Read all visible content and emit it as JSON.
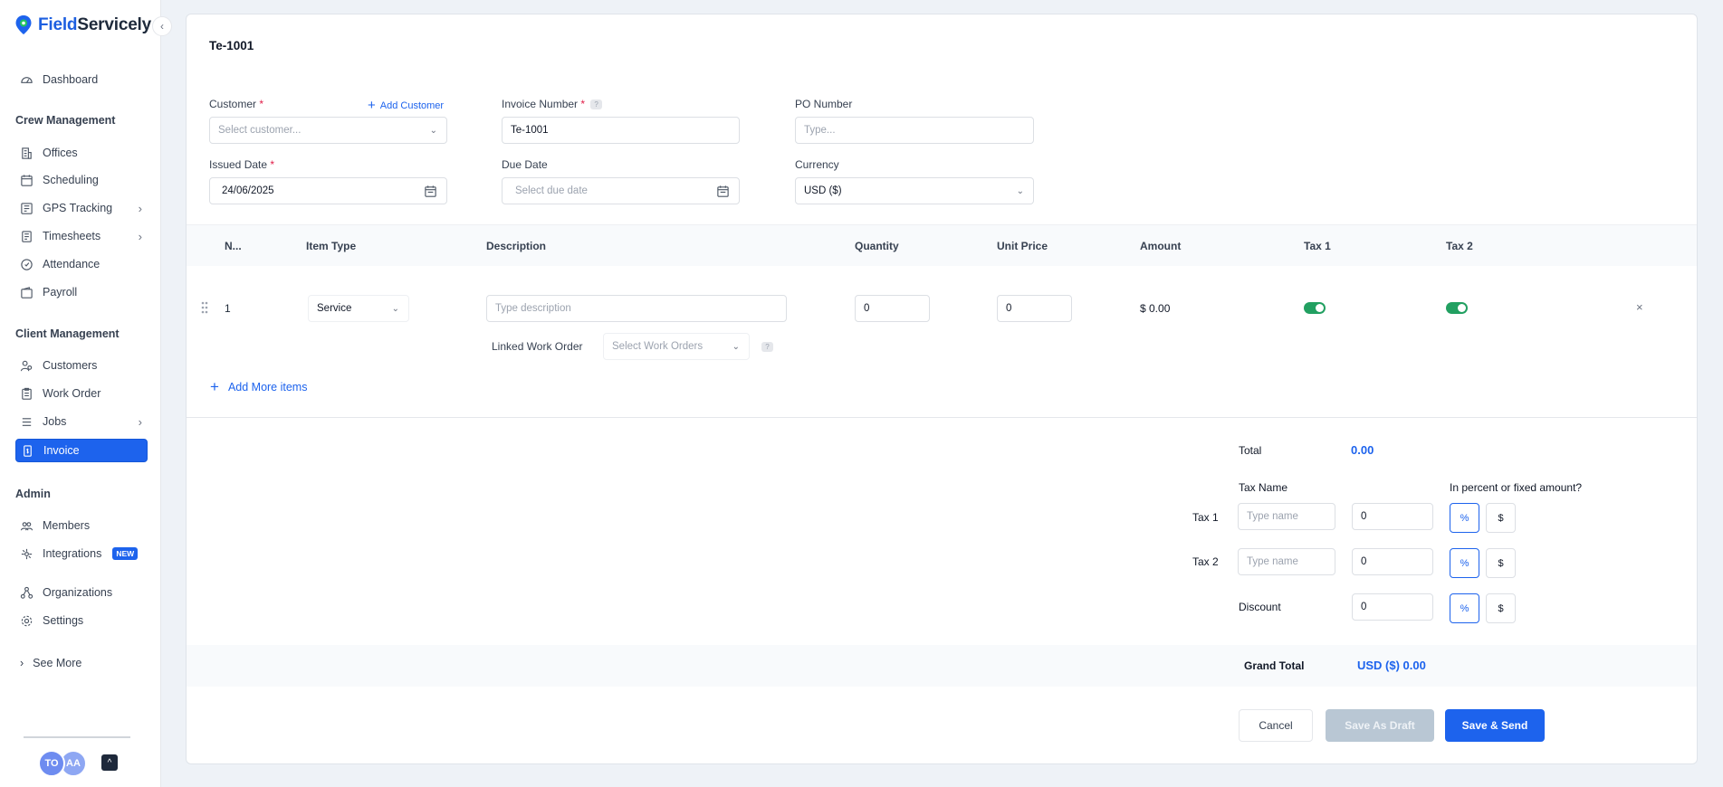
{
  "app": {
    "brand_part1": "Field",
    "brand_part2": "Servicely"
  },
  "sidebar": {
    "dashboard": "Dashboard",
    "section_crew": "Crew Management",
    "offices": "Offices",
    "scheduling": "Scheduling",
    "gps": "GPS Tracking",
    "timesheets": "Timesheets",
    "attendance": "Attendance",
    "payroll": "Payroll",
    "section_client": "Client Management",
    "customers": "Customers",
    "work_order": "Work Order",
    "jobs": "Jobs",
    "invoice": "Invoice",
    "section_admin": "Admin",
    "members": "Members",
    "integrations": "Integrations",
    "new_badge": "NEW",
    "organizations": "Organizations",
    "settings": "Settings",
    "see_more": "See More",
    "avatar1": "TO",
    "avatar2": "AA"
  },
  "form": {
    "title": "Te-1001",
    "customer_label": "Customer",
    "add_customer": "Add Customer",
    "customer_placeholder": "Select customer...",
    "invoice_number_label": "Invoice Number",
    "invoice_number_value": "Te-1001",
    "po_label": "PO Number",
    "po_placeholder": "Type...",
    "issued_label": "Issued Date",
    "issued_value": "24/06/2025",
    "due_label": "Due Date",
    "due_placeholder": "Select due date",
    "currency_label": "Currency",
    "currency_value": "USD ($)",
    "required_mark": "*",
    "help_mark": "?"
  },
  "table": {
    "headers": {
      "num": "N...",
      "item_type": "Item Type",
      "description": "Description",
      "quantity": "Quantity",
      "unit_price": "Unit Price",
      "amount": "Amount",
      "tax1": "Tax 1",
      "tax2": "Tax 2"
    },
    "row": {
      "num": "1",
      "item_type": "Service",
      "description_placeholder": "Type description",
      "quantity": "0",
      "unit_price": "0",
      "amount": "$ 0.00",
      "tax1_on": true,
      "tax2_on": true
    },
    "linked_label": "Linked Work Order",
    "linked_placeholder": "Select Work Orders",
    "add_more": "Add More items",
    "remove": "×"
  },
  "totals": {
    "total_label": "Total",
    "total_value": "0.00",
    "tax_name_label": "Tax Name",
    "percent_question": "In percent or fixed amount?",
    "tax1_label": "Tax 1",
    "tax2_label": "Tax 2",
    "name_placeholder": "Type name",
    "tax1_value": "0",
    "tax2_value": "0",
    "discount_label": "Discount",
    "discount_value": "0",
    "percent": "%",
    "dollar": "$",
    "grand_total_label": "Grand Total",
    "grand_total_value": "USD ($) 0.00"
  },
  "actions": {
    "cancel": "Cancel",
    "save_draft": "Save As Draft",
    "save_send": "Save & Send"
  },
  "colors": {
    "accent": "#1d63ed",
    "toggle_on": "#22a061",
    "required": "#e11d48"
  }
}
